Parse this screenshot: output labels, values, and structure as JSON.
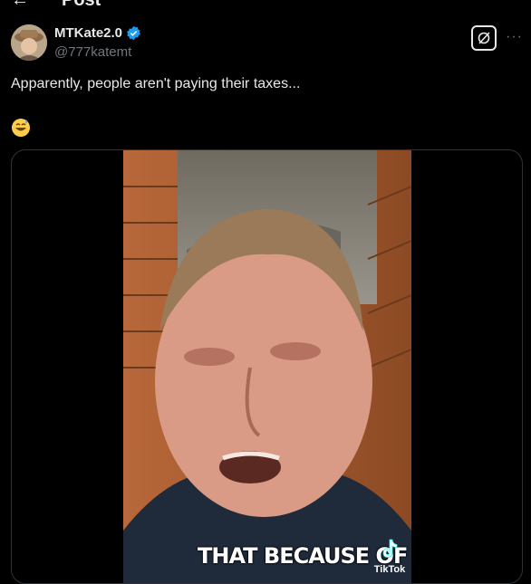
{
  "header": {
    "title": "Post"
  },
  "author": {
    "display_name": "MTKate2.0",
    "handle": "@777katemt"
  },
  "tweet": {
    "text": "Apparently, people aren't paying their taxes...",
    "emoji": "😅"
  },
  "media": {
    "caption": "THAT BECAUSE OF",
    "watermark": "TikTok"
  },
  "icons": {
    "back": "back-arrow-icon",
    "verified": "verified-badge-icon",
    "grok": "grok-icon",
    "more": "more-options-icon",
    "tiktok": "tiktok-logo-icon"
  },
  "colors": {
    "background": "#000000",
    "text": "#e7e9ea",
    "muted": "#71767b",
    "verified": "#1d9bf0",
    "border": "#2f3336"
  }
}
